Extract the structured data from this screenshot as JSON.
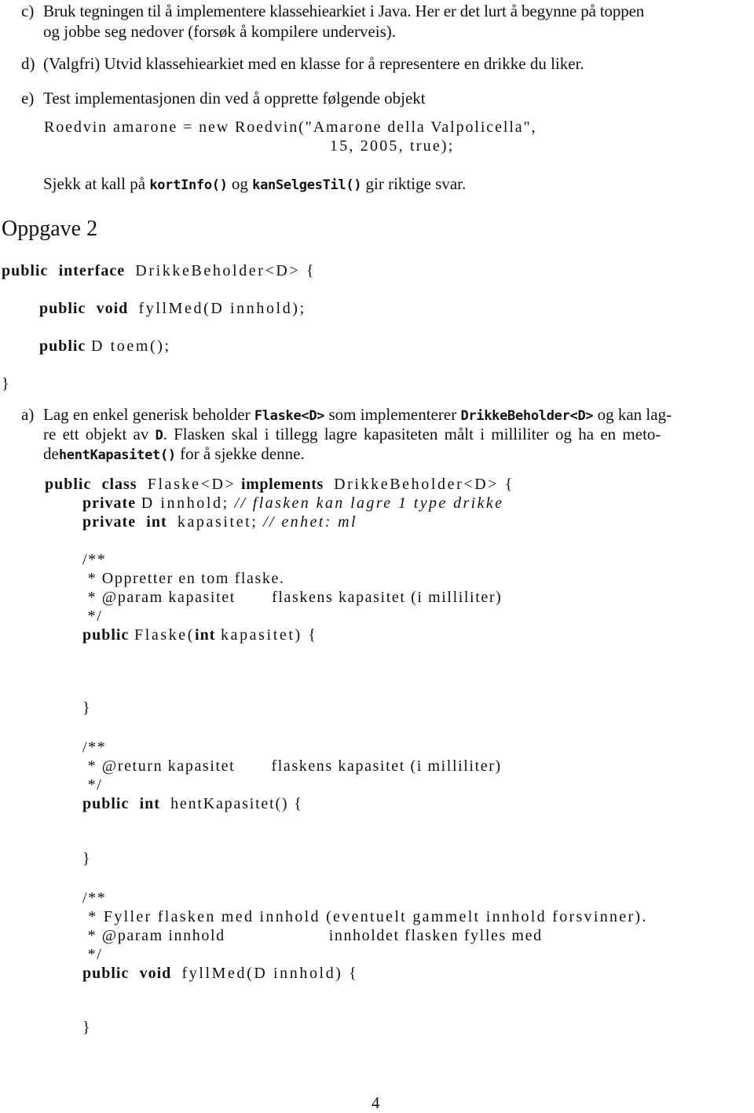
{
  "oppgave1": {
    "items": [
      {
        "label": "c)",
        "lines": [
          "Bruk tegningen til å implementere klassehiearkiet i Java. Her er det lurt å begynne på toppen",
          "og jobbe seg nedover (forsøk å kompilere underveis)."
        ]
      },
      {
        "label": "d)",
        "lines": [
          "(Valgfri) Utvid klassehiearkiet med en klasse for å representere en drikke du liker."
        ]
      },
      {
        "label": "e)",
        "lines": [
          "Test implementasjonen din ved å opprette følgende objekt"
        ]
      }
    ],
    "code_lines": [
      "Roedvin amarone = new Roedvin(\"Amarone della Valpolicella\",",
      "15, 2005, true);"
    ],
    "check_text": {
      "before": "Sjekk at kall på ",
      "method1": "kortInfo()",
      "middle": " og ",
      "method2": "kanSelgesTil()",
      "after": " gir riktige svar."
    }
  },
  "oppgave2": {
    "heading": "Oppgave 2",
    "interface": {
      "kw1": "public",
      "kw2": "interface",
      "name": "DrikkeBeholder<D> {",
      "m1_kw1": "public",
      "m1_kw2": "void",
      "m1_sig": "fyllMed(D innhold);",
      "m2_kw": "public",
      "m2_sig": "D toem();",
      "close": "}"
    },
    "task_a": {
      "label": "a)",
      "line1_a": "Lag en enkel generisk beholder ",
      "line1_code1": "Flaske<D>",
      "line1_b": " som implementerer ",
      "line1_code2": "DrikkeBeholder<D>",
      "line1_c": " og kan lag-",
      "line2_a": "re ett objekt av ",
      "line2_code": "D",
      "line2_b": ". Flasken skal i tillegg lagre kapasiteten målt i milliliter og ha en meto-",
      "line3_a": "de",
      "line3_code": "hentKapasitet()",
      "line3_b": " for å sjekke denne."
    },
    "class_code": {
      "l1_kw1": "public",
      "l1_kw2": "class",
      "l1_name": "Flaske<D>",
      "l1_kw3": "implements",
      "l1_rest": "DrikkeBeholder<D> {",
      "l2_kw": "private",
      "l2_rest": "D innhold;",
      "l2_comment": "// flasken kan lagre 1 type drikke",
      "l3_kw1": "private",
      "l3_kw2": "int",
      "l3_rest": "kapasitet;",
      "l3_comment": "// enhet: ml",
      "doc1": [
        "/**",
        " * Oppretter en tom flaske.",
        " * @param kapasitet       flaskens kapasitet (i milliliter)",
        " */"
      ],
      "ctor_kw1": "public",
      "ctor_name": "Flaske(",
      "ctor_kw2": "int",
      "ctor_rest": "kapasitet) {",
      "ctor_close": "}",
      "doc2": [
        "/**",
        " * @return kapasitet       flaskens kapasitet (i milliliter)",
        " */"
      ],
      "get_kw1": "public",
      "get_kw2": "int",
      "get_rest": "hentKapasitet() {",
      "get_close": "}",
      "doc3": [
        "/**",
        " * Fyller flasken med innhold (eventuelt gammelt innhold forsvinner).",
        " * @param innhold                    innholdet flasken fylles med",
        " */"
      ],
      "fyll_kw1": "public",
      "fyll_kw2": "void",
      "fyll_rest": "fyllMed(D innhold) {",
      "fyll_close": "}"
    }
  },
  "page_number": "4"
}
